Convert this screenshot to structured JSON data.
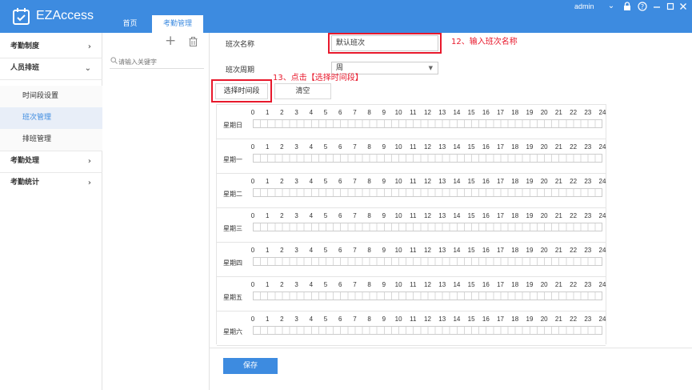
{
  "app": {
    "title": "EZAccess"
  },
  "nav": {
    "tabs": [
      {
        "label": "首页"
      },
      {
        "label": "考勤管理"
      }
    ]
  },
  "header": {
    "user": "admin"
  },
  "sidebar": {
    "groups": [
      {
        "label": "考勤制度"
      },
      {
        "label": "人员排班",
        "items": [
          {
            "label": "时间段设置"
          },
          {
            "label": "班次管理"
          },
          {
            "label": "排班管理"
          }
        ]
      },
      {
        "label": "考勤处理"
      },
      {
        "label": "考勤统计"
      }
    ]
  },
  "list_panel": {
    "search_placeholder": "请输入关键字"
  },
  "form": {
    "name_label": "班次名称",
    "name_value": "默认班次",
    "period_label": "班次周期",
    "period_value": "周",
    "select_period_button": "选择时间段",
    "clear_button": "清空",
    "save_button": "保存"
  },
  "annotations": {
    "step12": "12、输入班次名称",
    "step13": "13、点击【选择时间段】"
  },
  "schedule": {
    "hours": [
      "0",
      "1",
      "2",
      "3",
      "4",
      "5",
      "6",
      "7",
      "8",
      "9",
      "10",
      "11",
      "12",
      "13",
      "14",
      "15",
      "16",
      "17",
      "18",
      "19",
      "20",
      "21",
      "22",
      "23",
      "24"
    ],
    "days": [
      "星期日",
      "星期一",
      "星期二",
      "星期三",
      "星期四",
      "星期五",
      "星期六"
    ]
  },
  "colors": {
    "primary": "#3d8be0",
    "annotation": "#e8192c"
  }
}
